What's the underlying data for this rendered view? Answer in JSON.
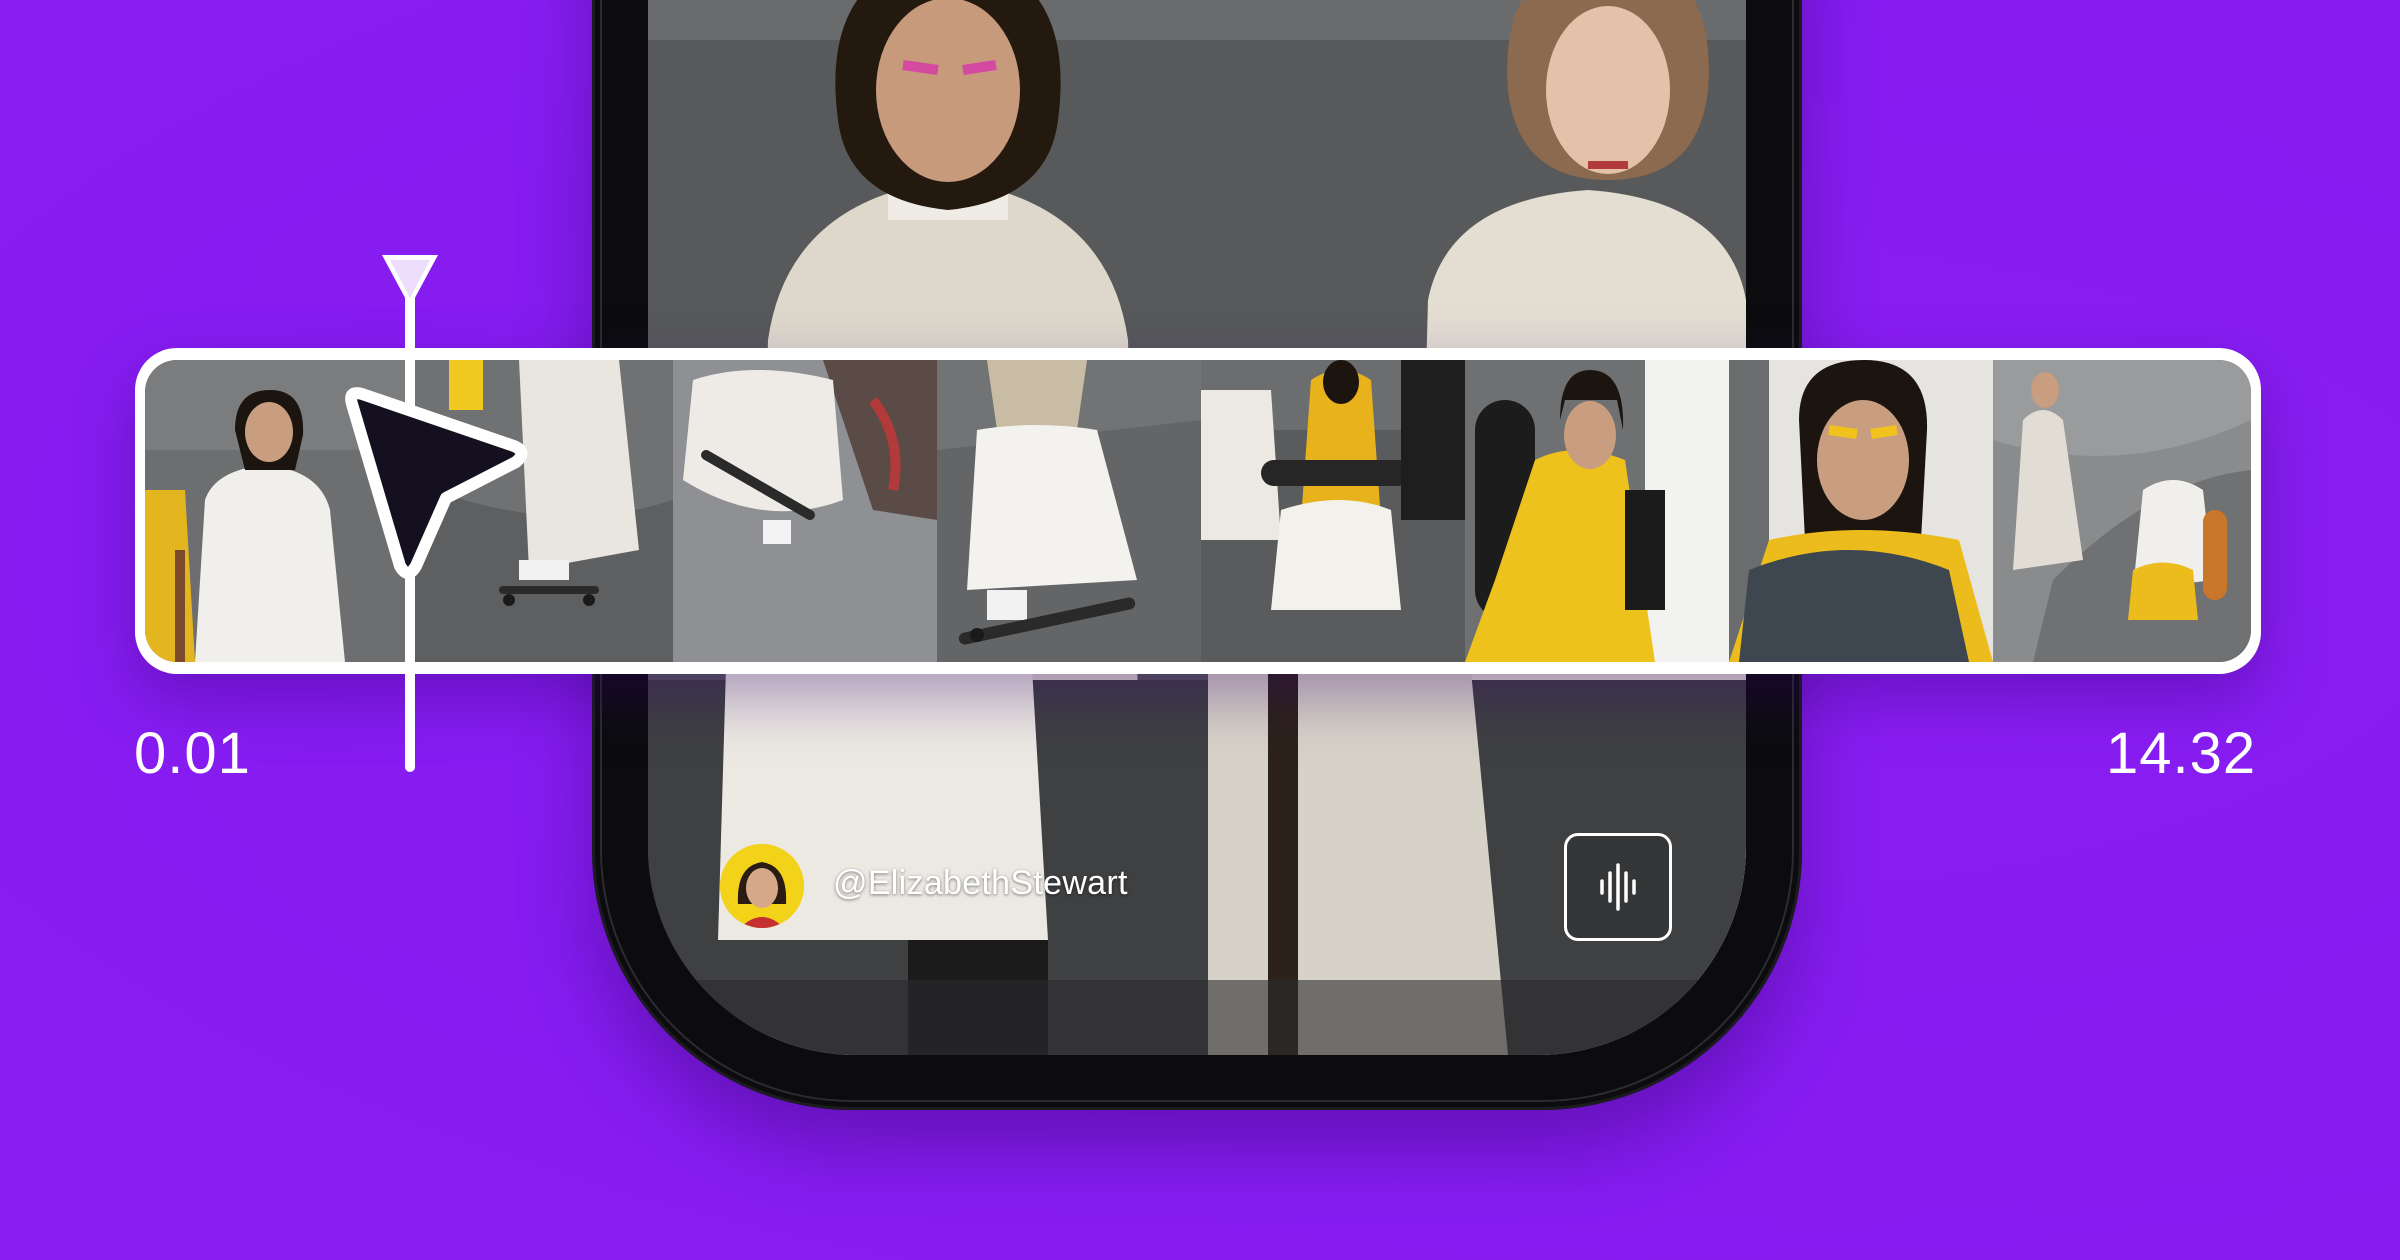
{
  "profile": {
    "handle": "@ElizabethStewart",
    "avatar": "avatar-icon"
  },
  "timeline": {
    "start_time": "0.01",
    "end_time": "14.32",
    "frame_count": 8,
    "playhead_icon": "playhead-marker-icon",
    "cursor_icon": "pointer-cursor-icon"
  },
  "controls": {
    "audio_icon": "audio-waveform-icon"
  },
  "colors": {
    "background": "#8a1ef2",
    "accent_yellow": "#f3d21a",
    "cursor_fill": "#15101f"
  }
}
